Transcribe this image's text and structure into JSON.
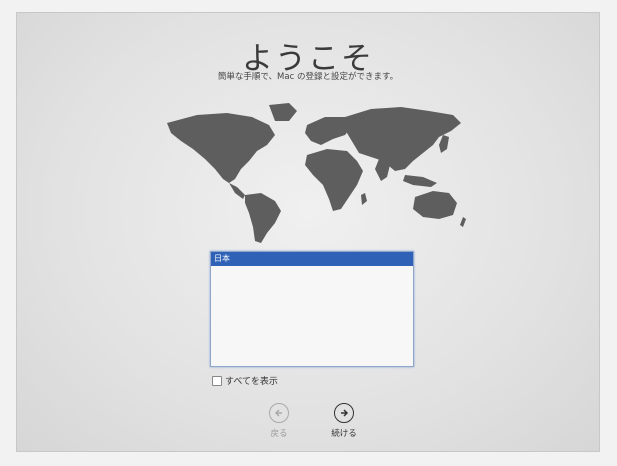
{
  "welcome": {
    "title": "ようこそ",
    "subtitle": "簡単な手順で、Mac の登録と設定ができます。"
  },
  "country_list": {
    "items": [
      "日本"
    ],
    "selected_index": 0
  },
  "show_all": {
    "label": "すべてを表示",
    "checked": false
  },
  "navigation": {
    "back_label": "戻る",
    "continue_label": "続ける",
    "back_icon": "arrow-left-circle-icon",
    "continue_icon": "arrow-right-circle-icon"
  },
  "colors": {
    "selection": "#2f62b7",
    "map": "#5e5e5e"
  }
}
